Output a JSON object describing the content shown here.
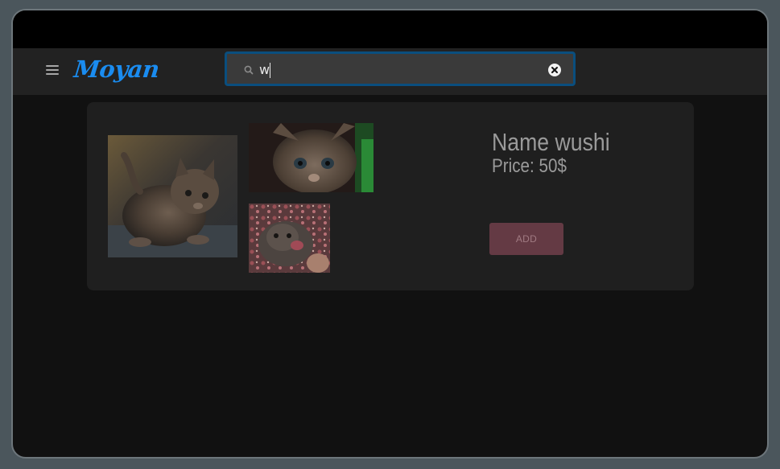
{
  "header": {
    "logo_text": "Moyan",
    "menu_icon": "hamburger-menu-icon"
  },
  "search": {
    "value": "w",
    "placeholder": "",
    "search_icon": "search-icon",
    "clear_icon": "close-icon"
  },
  "product": {
    "name_text": "Name wushi",
    "price_text": "Price: 50$",
    "add_label": "ADD",
    "images": [
      "kitten-photo",
      "kitten-photo",
      "kitten-photo"
    ]
  },
  "colors": {
    "accent": "#1a8cf0",
    "search_border": "#0a4e7e",
    "add_button": "#643a44",
    "card_bg": "#1f1f1f",
    "header_bg": "#222222",
    "page_bg": "#111111"
  }
}
